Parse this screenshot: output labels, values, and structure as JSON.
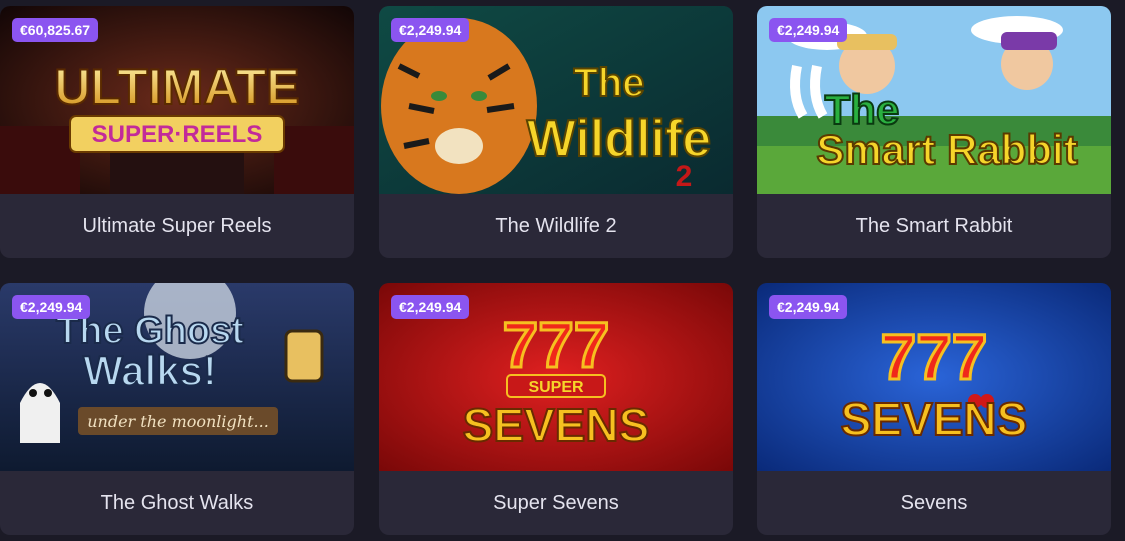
{
  "games": [
    {
      "title": "Ultimate Super Reels",
      "jackpot": "€60,825.67",
      "logo_line1": "ULTIMATE",
      "logo_line2": "SUPER·REELS"
    },
    {
      "title": "The Wildlife 2",
      "jackpot": "€2,249.94",
      "logo_line1": "The",
      "logo_line2": "Wildlife",
      "logo_line3": "2"
    },
    {
      "title": "The Smart Rabbit",
      "jackpot": "€2,249.94",
      "logo_line1": "The",
      "logo_line2": "Smart Rabbit"
    },
    {
      "title": "The Ghost Walks",
      "jackpot": "€2,249.94",
      "logo_line1": "The Ghost",
      "logo_line2": "Walks!",
      "logo_line3": "under the moonlight..."
    },
    {
      "title": "Super Sevens",
      "jackpot": "€2,249.94",
      "logo_line1": "777",
      "logo_line2": "SUPER",
      "logo_line3": "SEVENS"
    },
    {
      "title": "Sevens",
      "jackpot": "€2,249.94",
      "logo_line1": "777",
      "logo_line2": "SEVENS"
    }
  ],
  "colors": {
    "badge": "#8b55f0",
    "card_bg": "#2a2838",
    "page_bg": "#1b1a26"
  }
}
